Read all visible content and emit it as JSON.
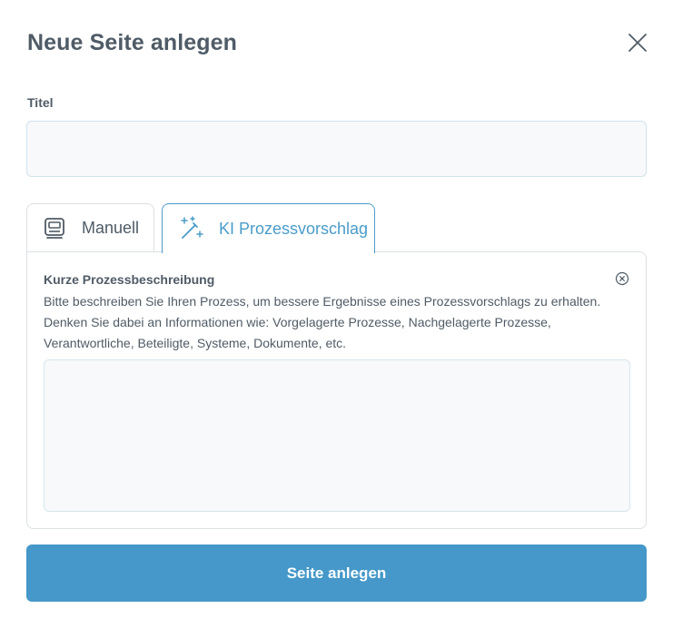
{
  "dialog": {
    "title": "Neue Seite anlegen",
    "close_icon": "close-icon"
  },
  "title_field": {
    "label": "Titel",
    "value": "",
    "placeholder": ""
  },
  "tabs": [
    {
      "label": "Manuell",
      "icon": "computer-icon",
      "active": false
    },
    {
      "label": "KI Prozessvorschlag",
      "icon": "magic-wand-icon",
      "active": true
    }
  ],
  "panel": {
    "title": "Kurze Prozessbeschreibung",
    "description": "Bitte beschreiben Sie Ihren Prozess, um bessere Ergebnisse eines Prozessvorschlags zu erhalten. Denken Sie dabei an Informationen wie: Vorgelagerte Prozesse, Nachgelagerte Prozesse, Verantwortliche, Beteiligte, Systeme, Dokumente, etc.",
    "close_icon": "close-circle-icon",
    "textarea_value": "",
    "textarea_placeholder": ""
  },
  "submit": {
    "label": "Seite anlegen"
  },
  "colors": {
    "accent": "#4598c9",
    "tab_active": "#4a9cc9",
    "text": "#4f5b66",
    "input_bg": "#f8f9fa"
  }
}
